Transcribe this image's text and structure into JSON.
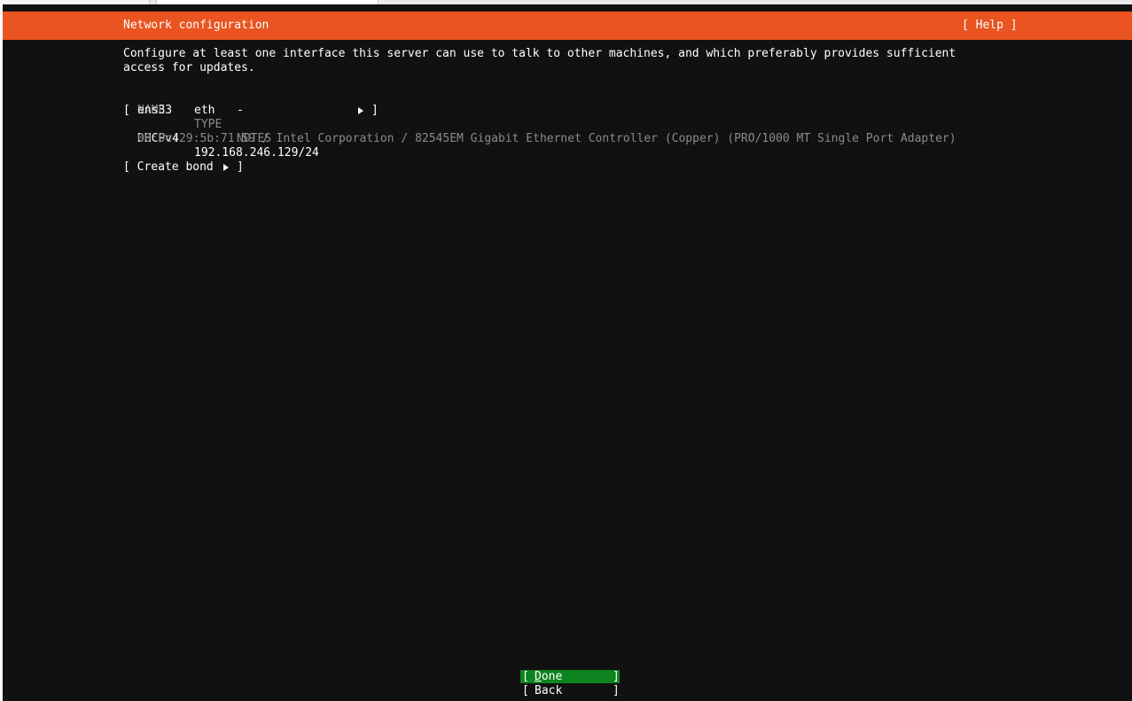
{
  "screen": {
    "title": "Network configuration",
    "help_label": "[ Help ]",
    "accent_color": "#e95420",
    "selected_color": "#0e8420"
  },
  "intro": {
    "line1": "Configure at least one interface this server can use to talk to other machines, and which preferably provides sufficient",
    "line2": "access for updates."
  },
  "table": {
    "headers": {
      "name": "NAME",
      "type": "TYPE",
      "notes": "NOTES"
    },
    "interfaces": [
      {
        "open_bracket": "[",
        "name": "ens33",
        "type": "eth",
        "notes": "-",
        "close_bracket": "]",
        "addr_method": "DHCPv4",
        "address": "192.168.246.129/24",
        "details": "00:0c:29:5b:71:59 / Intel Corporation / 82545EM Gigabit Ethernet Controller (Copper) (PRO/1000 MT Single Port Adapter)"
      }
    ]
  },
  "create_bond": {
    "label": "[ Create bond",
    "close": "]"
  },
  "buttons": {
    "open_bracket": "[",
    "close_bracket": "]",
    "done_label": "Done",
    "back_label": "Back"
  }
}
